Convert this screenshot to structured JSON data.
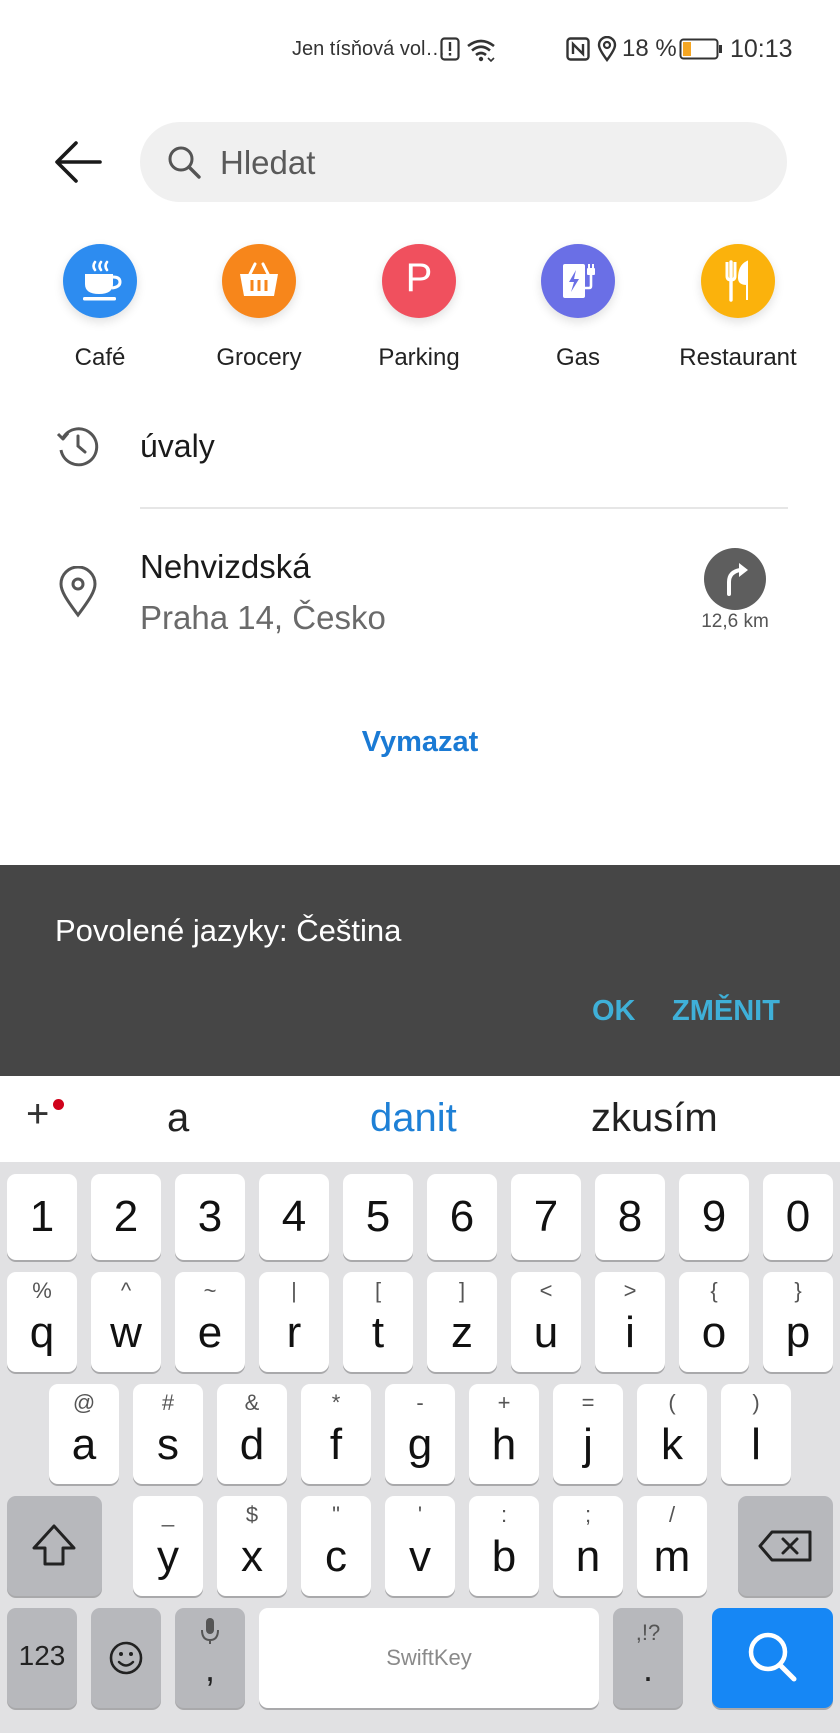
{
  "status_bar": {
    "carrier": "Jen tísňová vol…",
    "battery_percent": "18 %",
    "time": "10:13",
    "icons": [
      "alert-icon",
      "wifi-icon",
      "nfc-icon",
      "location-icon",
      "battery-icon"
    ],
    "battery_color": "#f5a623"
  },
  "search": {
    "placeholder": "Hledat",
    "value": ""
  },
  "categories": [
    {
      "label": "Café",
      "icon": "coffee-cup-icon",
      "color": "#2d8cf0"
    },
    {
      "label": "Grocery",
      "icon": "basket-icon",
      "color": "#f7861b"
    },
    {
      "label": "Parking",
      "icon": "parking-icon",
      "color": "#f0505e",
      "glyph": "P"
    },
    {
      "label": "Gas",
      "icon": "ev-charger-icon",
      "color": "#6a6fe6"
    },
    {
      "label": "Restaurant",
      "icon": "cutlery-icon",
      "color": "#fbb20c"
    }
  ],
  "history": [
    {
      "text": "úvaly",
      "icon": "history-icon"
    }
  ],
  "places": [
    {
      "name": "Nehvizdská",
      "address": "Praha 14, Česko",
      "distance": "12,6 km",
      "icon": "location-pin-icon"
    }
  ],
  "clear_label": "Vymazat",
  "snackbar": {
    "message": "Povolené jazyky: Čeština",
    "ok_label": "OK",
    "change_label": "ZMĚNIT"
  },
  "suggestions": {
    "words": [
      "a",
      "danit",
      "zkusím"
    ],
    "highlighted_index": 1
  },
  "keyboard": {
    "number_row": [
      "1",
      "2",
      "3",
      "4",
      "5",
      "6",
      "7",
      "8",
      "9",
      "0"
    ],
    "row1": [
      {
        "k": "q",
        "s": "%"
      },
      {
        "k": "w",
        "s": "^"
      },
      {
        "k": "e",
        "s": "~"
      },
      {
        "k": "r",
        "s": "|"
      },
      {
        "k": "t",
        "s": "["
      },
      {
        "k": "z",
        "s": "]"
      },
      {
        "k": "u",
        "s": "<"
      },
      {
        "k": "i",
        "s": ">"
      },
      {
        "k": "o",
        "s": "{"
      },
      {
        "k": "p",
        "s": "}"
      }
    ],
    "row2": [
      {
        "k": "a",
        "s": "@"
      },
      {
        "k": "s",
        "s": "#"
      },
      {
        "k": "d",
        "s": "&"
      },
      {
        "k": "f",
        "s": "*"
      },
      {
        "k": "g",
        "s": "-"
      },
      {
        "k": "h",
        "s": "+"
      },
      {
        "k": "j",
        "s": "="
      },
      {
        "k": "k",
        "s": "("
      },
      {
        "k": "l",
        "s": ")"
      }
    ],
    "row3": [
      {
        "k": "y",
        "s": "_"
      },
      {
        "k": "x",
        "s": "$"
      },
      {
        "k": "c",
        "s": "\""
      },
      {
        "k": "v",
        "s": "'"
      },
      {
        "k": "b",
        "s": ":"
      },
      {
        "k": "n",
        "s": ";"
      },
      {
        "k": "m",
        "s": "/"
      }
    ],
    "mode_label": "123",
    "comma": ",",
    "space_brand": "SwiftKey",
    "period": ".",
    "period_alt": ",!?",
    "accent_color": "#1687f5"
  }
}
